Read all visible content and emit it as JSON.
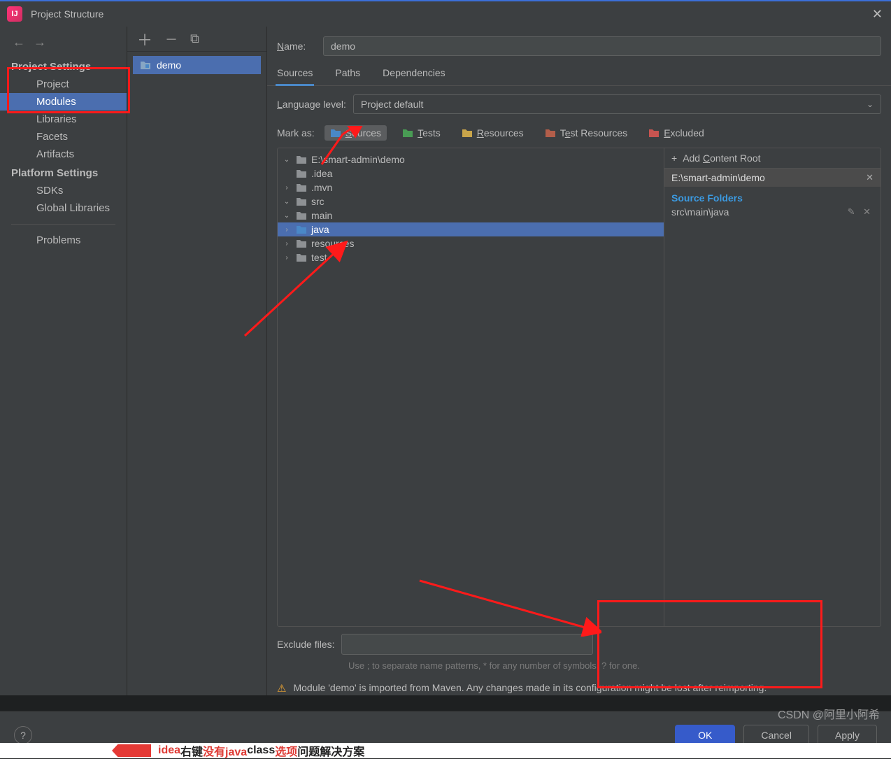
{
  "window": {
    "title": "Project Structure"
  },
  "sidebar": {
    "sections": {
      "project_settings": {
        "title": "Project Settings",
        "items": [
          "Project",
          "Modules",
          "Libraries",
          "Facets",
          "Artifacts"
        ]
      },
      "platform_settings": {
        "title": "Platform Settings",
        "items": [
          "SDKs",
          "Global Libraries"
        ]
      },
      "problems": "Problems"
    }
  },
  "middle": {
    "module_name": "demo"
  },
  "right": {
    "name_label": "Name:",
    "name_value": "demo",
    "tabs": [
      "Sources",
      "Paths",
      "Dependencies"
    ],
    "language_level_label": "Language level:",
    "language_level_value": "Project default",
    "mark_as_label": "Mark as:",
    "mark_buttons": {
      "sources": "Sources",
      "tests": "Tests",
      "resources": "Resources",
      "test_resources": "Test Resources",
      "excluded": "Excluded"
    },
    "tree": {
      "root": "E:\\smart-admin\\demo",
      "idea": ".idea",
      "mvn": ".mvn",
      "src": "src",
      "main": "main",
      "java": "java",
      "resources": "resources",
      "test": "test"
    },
    "side": {
      "add_content_root": "Add Content Root",
      "content_root_path": "E:\\smart-admin\\demo",
      "source_folders_title": "Source Folders",
      "source_folder_0": "src\\main\\java"
    },
    "exclude_label": "Exclude files:",
    "exclude_hint": "Use ; to separate name patterns, * for any number of symbols, ? for one.",
    "warning": "Module 'demo' is imported from Maven. Any changes made in its configuration might be lost after reimporting."
  },
  "footer": {
    "ok": "OK",
    "cancel": "Cancel",
    "apply": "Apply"
  },
  "watermark": "CSDN @阿里小阿希",
  "bottom_strip": {
    "red1": "idea",
    "black1": "右键",
    "red2": "没有java",
    "black2": " class",
    "red3": "选项",
    "black3": "问题解决方案"
  },
  "colors": {
    "sources": "#4a88c7",
    "tests": "#499c54",
    "resources": "#c9a54a",
    "test_resources": "#b35e4a",
    "excluded": "#c75450"
  }
}
